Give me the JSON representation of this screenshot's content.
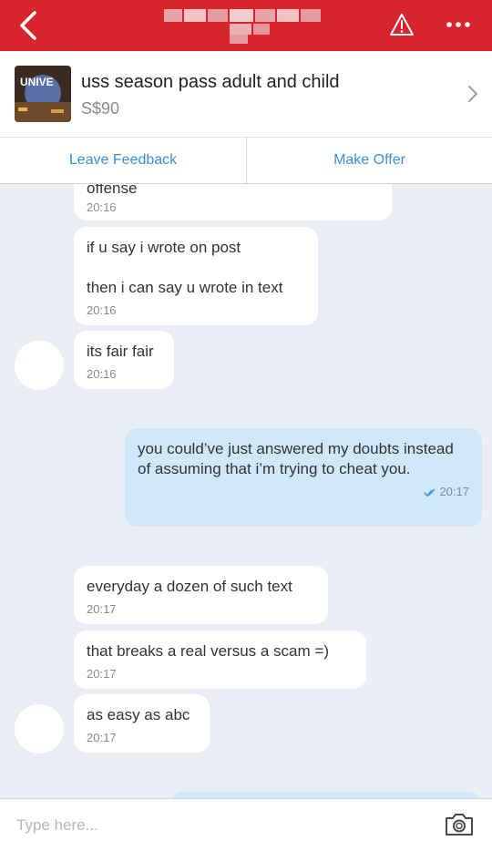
{
  "listing": {
    "title": "uss season pass adult and child",
    "price": "S$90",
    "thumb_text": "UNIVE"
  },
  "actions": {
    "leave_feedback": "Leave Feedback",
    "make_offer": "Make Offer"
  },
  "messages": [
    {
      "text": "offense",
      "time": "20:16"
    },
    {
      "text_line1": "if u say i wrote on post",
      "text_line2": "then i can say u wrote in text",
      "time": "20:16"
    },
    {
      "text": "its fair fair",
      "time": "20:16"
    },
    {
      "text": "you could’ve just answered my doubts instead of assuming that i’m trying to cheat you.",
      "time": "20:17"
    },
    {
      "text": "everyday a dozen of such text",
      "time": "20:17"
    },
    {
      "text": "that breaks a real versus a scam =)",
      "time": "20:17"
    },
    {
      "text": "as easy as abc",
      "time": "20:17"
    }
  ],
  "input": {
    "placeholder": "Type here..."
  },
  "colors": {
    "brand": "#d8242c",
    "accent": "#3e8fd1",
    "sent_bubble": "#cfe9fb"
  },
  "icons": [
    "back-icon",
    "warning-icon",
    "more-icon",
    "chevron-right-icon",
    "read-check-icon",
    "camera-icon"
  ]
}
